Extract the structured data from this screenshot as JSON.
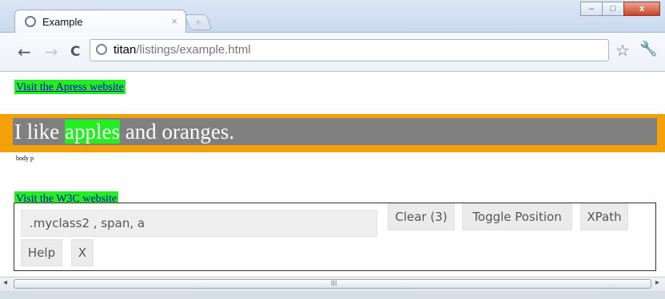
{
  "browser": {
    "tab_title": "Example",
    "tab_close": "×",
    "new_tab": "+",
    "url_host": "titan",
    "url_path": "/listings/example.html",
    "nav_back": "←",
    "nav_forward": "→",
    "nav_reload": "C",
    "star": "☆",
    "wrench": "🔧",
    "win_min": "–",
    "win_max": "□",
    "win_close": "x"
  },
  "page": {
    "link1": "Visit the Apress website",
    "para_before": "I like ",
    "para_highlight": "apples",
    "para_after": " and oranges.",
    "path_label": "body p",
    "link2": "Visit the W3C website"
  },
  "panel": {
    "selector_value": ".myclass2 , span, a",
    "clear_label": "Clear (3)",
    "toggle_label": "Toggle Position",
    "xpath_label": "XPath",
    "help_label": "Help",
    "close_label": "X"
  },
  "scrollbar": {
    "left_arrow": "◂",
    "right_arrow": "▸",
    "grip": "III"
  }
}
